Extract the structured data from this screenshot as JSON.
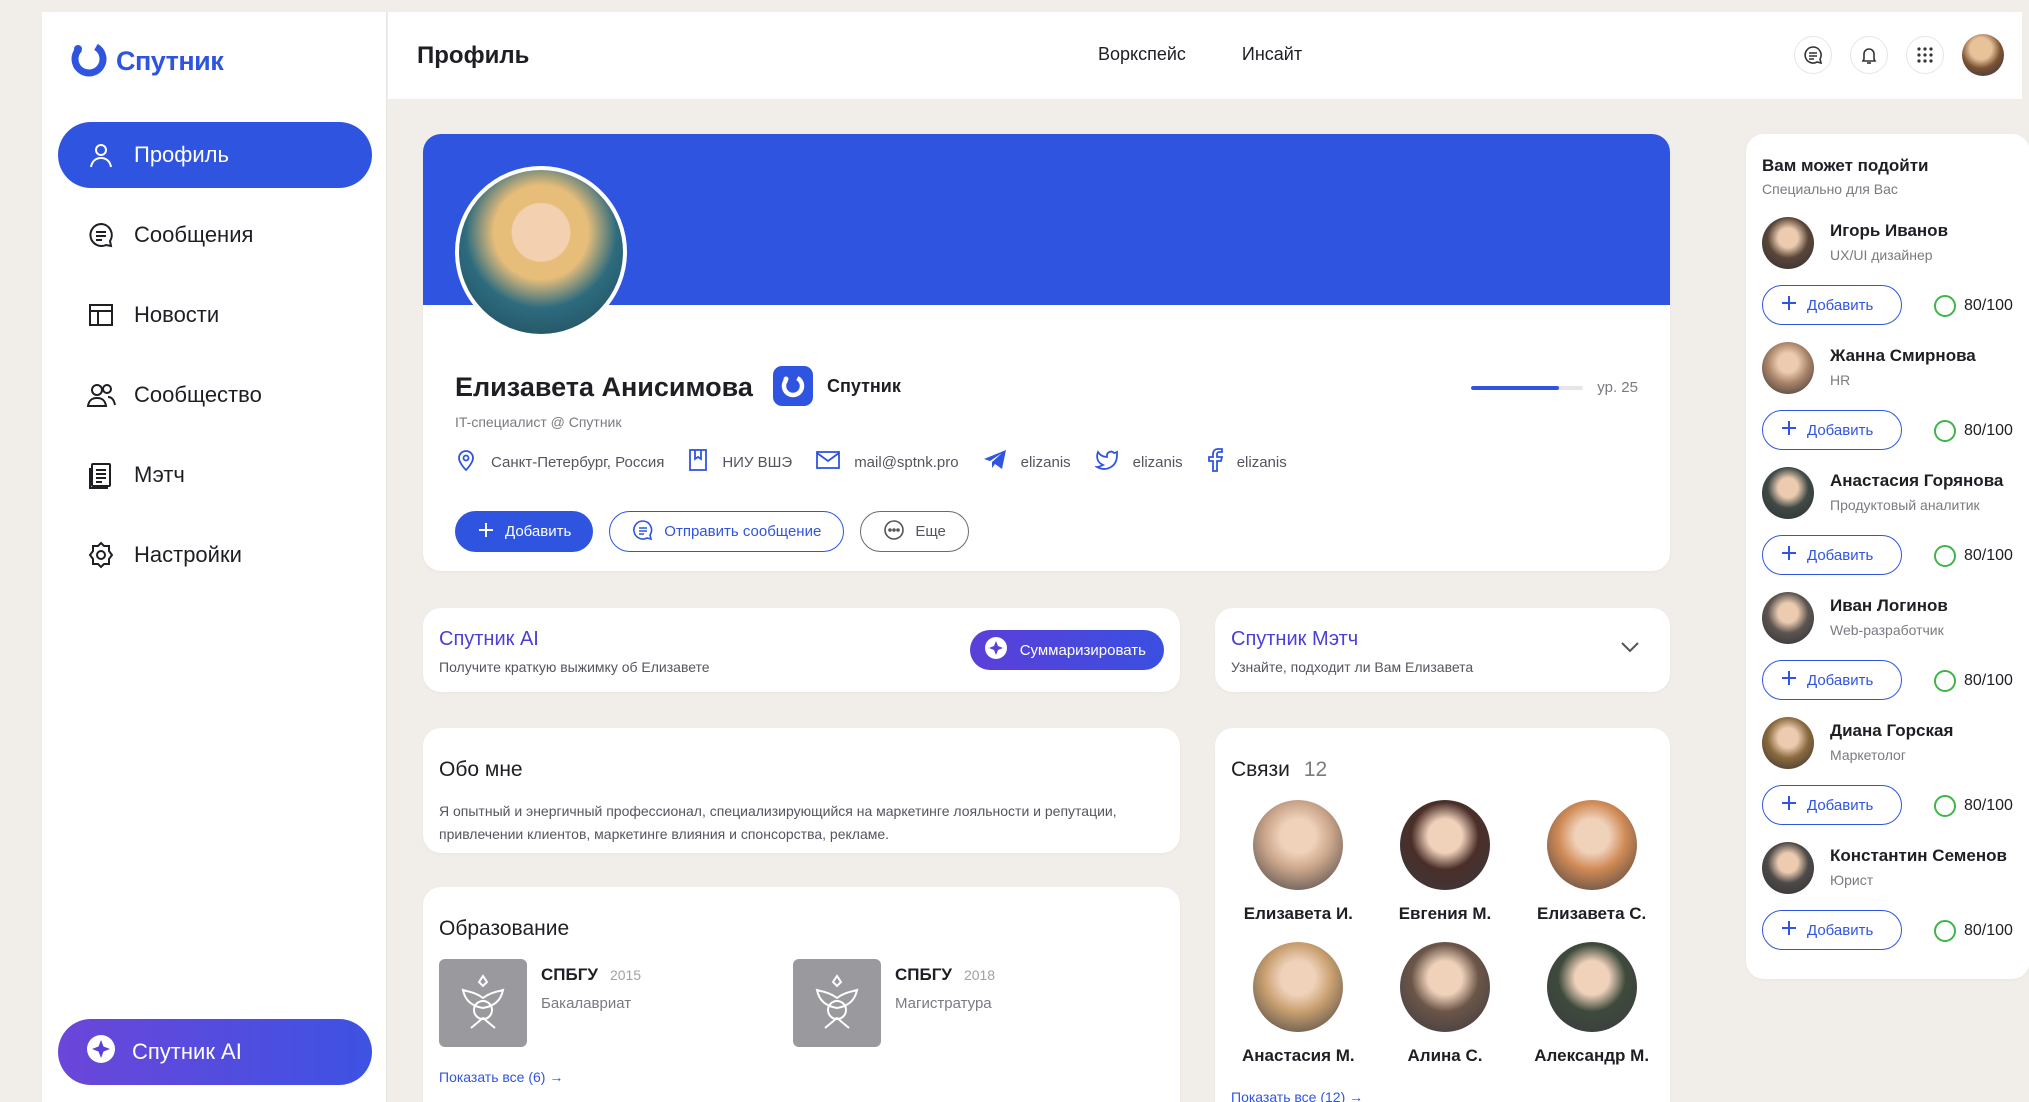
{
  "app": {
    "name": "Спутник"
  },
  "sidebar": {
    "items": [
      {
        "label": "Профиль",
        "icon": "user-icon",
        "active": true
      },
      {
        "label": "Сообщения",
        "icon": "message-icon"
      },
      {
        "label": "Новости",
        "icon": "news-icon"
      },
      {
        "label": "Сообщество",
        "icon": "community-icon"
      },
      {
        "label": "Мэтч",
        "icon": "match-icon"
      },
      {
        "label": "Настройки",
        "icon": "gear-icon"
      }
    ],
    "ai_button": "Спутник AI"
  },
  "header": {
    "title": "Профиль",
    "nav": [
      "Воркспейс",
      "Инсайт"
    ],
    "icons": [
      "chat-icon",
      "bell-icon",
      "apps-grid-icon"
    ]
  },
  "profile": {
    "name": "Елизавета Анисимова",
    "company": "Спутник",
    "role": "IT-специалист @ Спутник",
    "level_text": "ур. 25",
    "level_progress": 0.78,
    "location": "Санкт-Петербург, Россия",
    "university": "НИУ ВШЭ",
    "email": "mail@sptnk.pro",
    "telegram": "elizanis",
    "twitter": "elizanis",
    "facebook": "elizanis",
    "btn_add": "Добавить",
    "btn_message": "Отправить сообщение",
    "btn_more": "Еще"
  },
  "ai_card": {
    "title": "Спутник AI",
    "subtitle": "Получите краткую выжимку об Елизавете",
    "button": "Суммаризировать"
  },
  "match_card": {
    "title": "Спутник Мэтч",
    "subtitle": "Узнайте, подходит ли Вам Елизавета"
  },
  "about": {
    "title": "Обо мне",
    "text": "Я опытный и энергичный профессионал, специализирующийся на маркетинге лояльности и репутации, привлечении клиентов, маркетинге влияния и спонсорства, рекламе."
  },
  "education": {
    "title": "Образование",
    "items": [
      {
        "name": "СПБГУ",
        "year": "2015",
        "degree": "Бакалавриат"
      },
      {
        "name": "СПБГУ",
        "year": "2018",
        "degree": "Магистратура"
      }
    ],
    "show_all": "Показать все (6) →"
  },
  "connections": {
    "title": "Связи",
    "count": "12",
    "people": [
      {
        "name": "Елизавета И.",
        "color": "#caa58a"
      },
      {
        "name": "Евгения М.",
        "color": "#4a2e28"
      },
      {
        "name": "Елизавета С.",
        "color": "#d08a55"
      },
      {
        "name": "Анастасия М.",
        "color": "#c9a070"
      },
      {
        "name": "Алина С.",
        "color": "#6b5548"
      },
      {
        "name": "Александр М.",
        "color": "#3e4a3c"
      }
    ],
    "show_all": "Показать все (12) →"
  },
  "suggestions": {
    "title": "Вам может подойти",
    "subtitle": "Специально для Вас",
    "add_label": "Добавить",
    "people": [
      {
        "name": "Игорь Иванов",
        "role": "UX/UI дизайнер",
        "score": "80/100",
        "color": "#5a4638"
      },
      {
        "name": "Жанна Смирнова",
        "role": "HR",
        "score": "80/100",
        "color": "#a98468"
      },
      {
        "name": "Анастасия Горянова",
        "role": "Продуктовый аналитик",
        "score": "80/100",
        "color": "#3f4a46"
      },
      {
        "name": "Иван Логинов",
        "role": "Web-разработчик",
        "score": "80/100",
        "color": "#5c5450"
      },
      {
        "name": "Диана Горская",
        "role": "Маркетолог",
        "score": "80/100",
        "color": "#8a6a3e"
      },
      {
        "name": "Константин Семенов",
        "role": "Юрист",
        "score": "80/100",
        "color": "#4e4a48"
      }
    ]
  },
  "colors": {
    "brand": "#2f55e0",
    "ai_purple": "#4a3fd9",
    "score_green": "#3db54a"
  }
}
